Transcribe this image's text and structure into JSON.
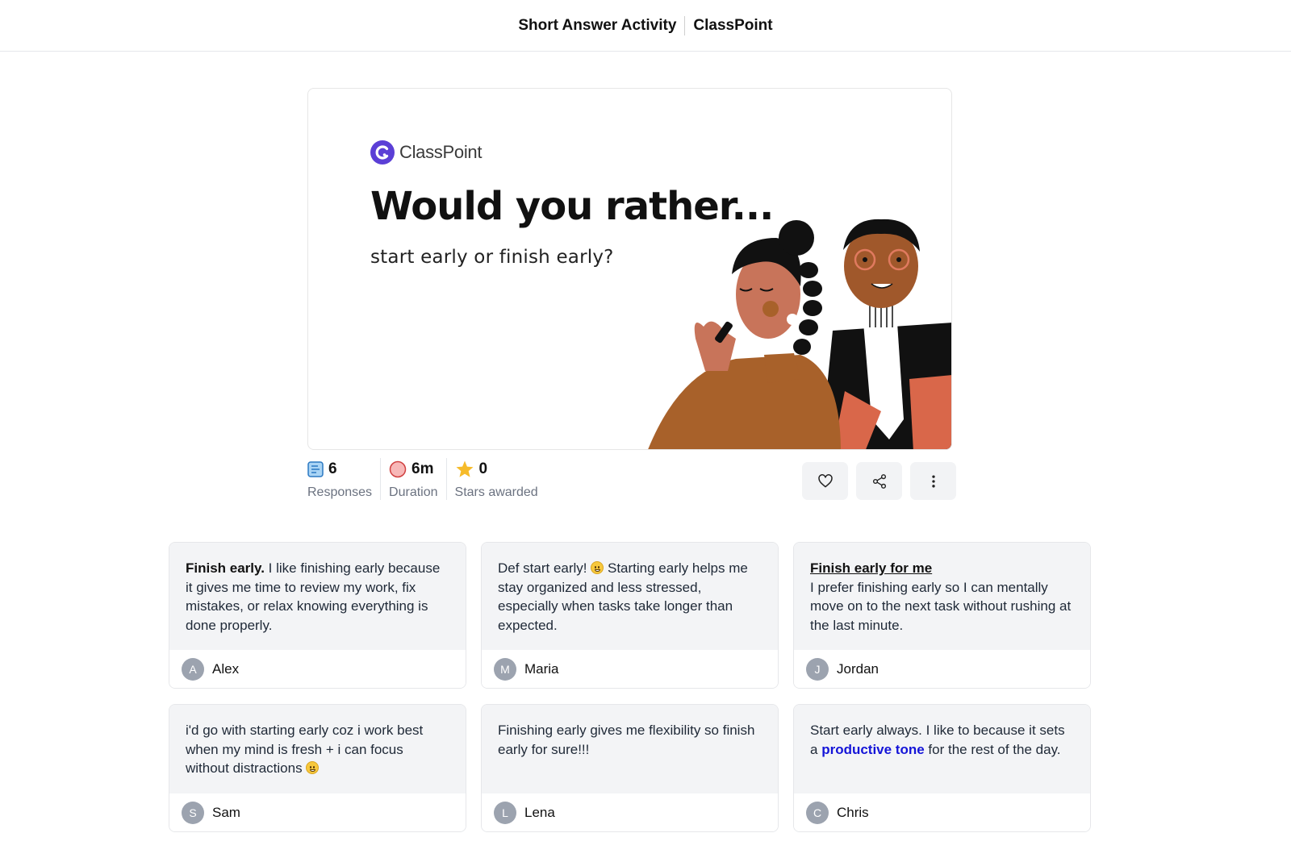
{
  "header": {
    "title": "Short Answer Activity",
    "brand": "ClassPoint"
  },
  "slide": {
    "brand": "ClassPoint",
    "title": "Would you rather...",
    "subtitle": "start early or finish early?"
  },
  "stats": [
    {
      "value": "6",
      "label": "Responses",
      "icon": "responses-icon"
    },
    {
      "value": "6m",
      "label": "Duration",
      "icon": "duration-icon"
    },
    {
      "value": "0",
      "label": "Stars awarded",
      "icon": "star-icon"
    }
  ],
  "actions": [
    "heart-icon",
    "share-icon",
    "more-vertical-icon"
  ],
  "responses": [
    {
      "lead": "Finish early.",
      "text": " I like finishing early because it gives me time to review my work, fix mistakes, or relax knowing everything is done properly.",
      "initial": "A",
      "name": "Alex"
    },
    {
      "text_before": "Def start early! ",
      "text_after": " Starting early helps me stay organized and less stressed, especially when tasks take longer than expected.",
      "initial": "M",
      "name": "Maria"
    },
    {
      "lead": "Finish early for me",
      "text": "I prefer finishing early so I can mentally move on to the next task without rushing at the last minute.",
      "initial": "J",
      "name": "Jordan"
    },
    {
      "text_before": "i'd go with starting early coz i work best when my mind is fresh + i can focus without distractions ",
      "initial": "S",
      "name": "Sam"
    },
    {
      "text": "Finishing early gives me flexibility so finish early for sure!!!",
      "initial": "L",
      "name": "Lena"
    },
    {
      "text_before": "Start early always. I like to because it sets a ",
      "highlight": "productive tone",
      "text_after": " for the rest of the day.",
      "initial": "C",
      "name": "Chris"
    }
  ],
  "colors": {
    "brand_purple": "#5b3fd6",
    "highlight_blue": "#1414d8",
    "card_bg": "#f3f4f6"
  }
}
